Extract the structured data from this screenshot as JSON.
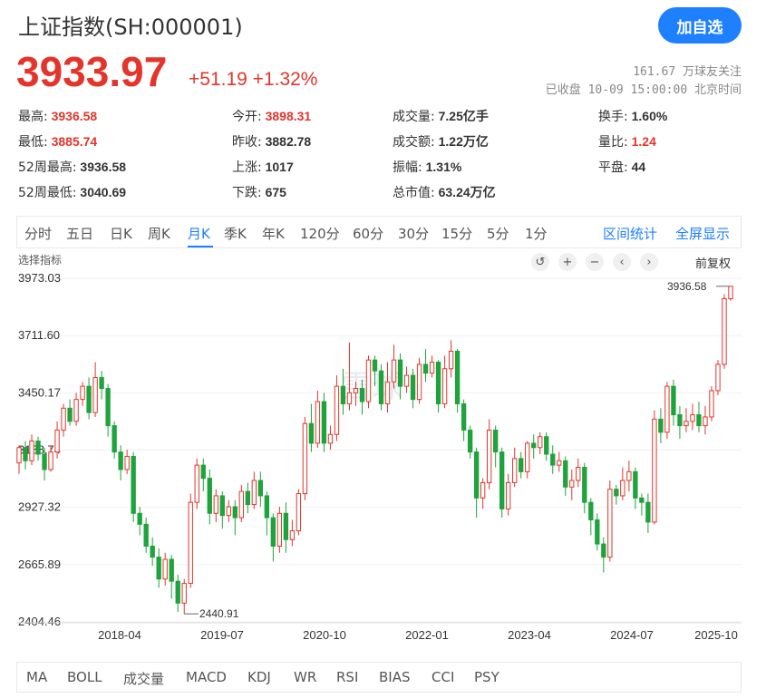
{
  "header": {
    "title": "上证指数(SH:000001)",
    "follow_label": "加自选",
    "price": "3933.97",
    "change": "+51.19",
    "change_pct": "+1.32%",
    "followers": "161.67 万球友关注",
    "status": "已收盘 10-09 15:00:00 北京时间"
  },
  "stats": [
    {
      "label": "最高:",
      "value": "3936.58",
      "red": true
    },
    {
      "label": "今开:",
      "value": "3898.31",
      "red": true
    },
    {
      "label": "成交量:",
      "value": "7.25亿手",
      "red": false
    },
    {
      "label": "换手:",
      "value": "1.60%",
      "red": false
    },
    {
      "label": "最低:",
      "value": "3885.74",
      "red": true
    },
    {
      "label": "昨收:",
      "value": "3882.78",
      "red": false
    },
    {
      "label": "成交额:",
      "value": "1.22万亿",
      "red": false
    },
    {
      "label": "量比:",
      "value": "1.24",
      "red": true
    },
    {
      "label": "52周最高:",
      "value": "3936.58",
      "red": false
    },
    {
      "label": "上涨:",
      "value": "1017",
      "red": false
    },
    {
      "label": "振幅:",
      "value": "1.31%",
      "red": false
    },
    {
      "label": "平盘:",
      "value": "44",
      "red": false
    },
    {
      "label": "52周最低:",
      "value": "3040.69",
      "red": false
    },
    {
      "label": "下跌:",
      "value": "675",
      "red": false
    },
    {
      "label": "总市值:",
      "value": "63.24万亿",
      "red": false
    }
  ],
  "period_tabs": [
    "分时",
    "五日",
    "日K",
    "周K",
    "月K",
    "季K",
    "年K",
    "120分",
    "60分",
    "30分",
    "15分",
    "5分",
    "1分"
  ],
  "active_tab": "月K",
  "right_tabs": [
    "区间统计",
    "全屏显示"
  ],
  "indicator_select": "选择指标",
  "controls": {
    "reset": "↺",
    "zoom_in": "+",
    "zoom_out": "−",
    "prev": "‹",
    "next": "›"
  },
  "adjust_label": "前复权",
  "watermark": "雪球",
  "bottom_tabs": [
    "MA",
    "BOLL",
    "成交量",
    "MACD",
    "KDJ",
    "WR",
    "RSI",
    "BIAS",
    "CCI",
    "PSY"
  ],
  "colors": {
    "up": "#e3352b",
    "down": "#1fa33c",
    "accent": "#1e80ff"
  },
  "chart_data": {
    "type": "candlestick",
    "y_ticks": [
      "3973.03",
      "3711.60",
      "3450.17",
      "3188.74",
      "2927.32",
      "2665.89",
      "2404.46"
    ],
    "ylim": [
      2404.46,
      3973.03
    ],
    "x_ticks": [
      "2018-04",
      "2019-07",
      "2020-10",
      "2022-01",
      "2023-04",
      "2024-07",
      "2025-10"
    ],
    "annotations": {
      "max": "3936.58",
      "min": "2440.91"
    },
    "candles": [
      [
        3130,
        3200,
        3080,
        3210
      ],
      [
        3200,
        3140,
        3100,
        3230
      ],
      [
        3140,
        3230,
        3120,
        3260
      ],
      [
        3230,
        3170,
        3140,
        3250
      ],
      [
        3170,
        3100,
        3050,
        3200
      ],
      [
        3100,
        3180,
        3090,
        3210
      ],
      [
        3180,
        3280,
        3150,
        3320
      ],
      [
        3280,
        3380,
        3250,
        3400
      ],
      [
        3380,
        3320,
        3300,
        3420
      ],
      [
        3320,
        3420,
        3300,
        3450
      ],
      [
        3420,
        3480,
        3390,
        3500
      ],
      [
        3480,
        3360,
        3330,
        3520
      ],
      [
        3360,
        3520,
        3340,
        3590
      ],
      [
        3520,
        3470,
        3420,
        3550
      ],
      [
        3470,
        3300,
        3250,
        3490
      ],
      [
        3300,
        3180,
        3150,
        3320
      ],
      [
        3180,
        3100,
        3050,
        3210
      ],
      [
        3100,
        3160,
        3080,
        3190
      ],
      [
        3160,
        2900,
        2860,
        3180
      ],
      [
        2900,
        2850,
        2800,
        2930
      ],
      [
        2850,
        2750,
        2720,
        2880
      ],
      [
        2750,
        2700,
        2660,
        2790
      ],
      [
        2700,
        2600,
        2560,
        2740
      ],
      [
        2600,
        2690,
        2570,
        2720
      ],
      [
        2690,
        2590,
        2510,
        2710
      ],
      [
        2590,
        2490,
        2450,
        2620
      ],
      [
        2490,
        2580,
        2440,
        2600
      ],
      [
        2580,
        2950,
        2560,
        2990
      ],
      [
        2950,
        3120,
        2920,
        3150
      ],
      [
        3120,
        3060,
        3000,
        3150
      ],
      [
        3060,
        2900,
        2850,
        3100
      ],
      [
        2900,
        2980,
        2860,
        3010
      ],
      [
        2980,
        2890,
        2830,
        3000
      ],
      [
        2890,
        2930,
        2860,
        2960
      ],
      [
        2930,
        2880,
        2800,
        2960
      ],
      [
        2880,
        3000,
        2860,
        3030
      ],
      [
        3000,
        2940,
        2900,
        3040
      ],
      [
        2940,
        3050,
        2920,
        3090
      ],
      [
        3050,
        2980,
        2930,
        3090
      ],
      [
        2980,
        2880,
        2800,
        3000
      ],
      [
        2880,
        2750,
        2680,
        2900
      ],
      [
        2750,
        2900,
        2720,
        2930
      ],
      [
        2900,
        2780,
        2720,
        2950
      ],
      [
        2780,
        2820,
        2750,
        2870
      ],
      [
        2820,
        2990,
        2800,
        3010
      ],
      [
        2990,
        3310,
        2960,
        3340
      ],
      [
        3310,
        3220,
        3180,
        3400
      ],
      [
        3220,
        3410,
        3200,
        3460
      ],
      [
        3410,
        3220,
        3180,
        3450
      ],
      [
        3220,
        3260,
        3190,
        3300
      ],
      [
        3260,
        3480,
        3230,
        3530
      ],
      [
        3480,
        3400,
        3350,
        3560
      ],
      [
        3400,
        3450,
        3370,
        3680
      ],
      [
        3450,
        3470,
        3390,
        3500
      ],
      [
        3470,
        3410,
        3350,
        3510
      ],
      [
        3410,
        3600,
        3380,
        3620
      ],
      [
        3600,
        3550,
        3480,
        3620
      ],
      [
        3550,
        3400,
        3370,
        3580
      ],
      [
        3400,
        3500,
        3360,
        3590
      ],
      [
        3500,
        3600,
        3470,
        3670
      ],
      [
        3600,
        3480,
        3420,
        3630
      ],
      [
        3480,
        3530,
        3450,
        3570
      ],
      [
        3530,
        3420,
        3380,
        3560
      ],
      [
        3420,
        3580,
        3400,
        3610
      ],
      [
        3580,
        3540,
        3500,
        3650
      ],
      [
        3540,
        3590,
        3520,
        3620
      ],
      [
        3590,
        3400,
        3360,
        3600
      ],
      [
        3400,
        3560,
        3380,
        3620
      ],
      [
        3560,
        3640,
        3520,
        3690
      ],
      [
        3640,
        3400,
        3360,
        3650
      ],
      [
        3400,
        3280,
        3230,
        3420
      ],
      [
        3280,
        3180,
        3150,
        3300
      ],
      [
        3180,
        2970,
        2880,
        3200
      ],
      [
        2970,
        3040,
        2920,
        3060
      ],
      [
        3040,
        3280,
        3010,
        3330
      ],
      [
        3280,
        3180,
        3110,
        3300
      ],
      [
        3180,
        2920,
        2880,
        3200
      ],
      [
        2920,
        3040,
        2890,
        3080
      ],
      [
        3040,
        3150,
        3020,
        3200
      ],
      [
        3150,
        3090,
        3060,
        3180
      ],
      [
        3090,
        3220,
        3060,
        3230
      ],
      [
        3220,
        3200,
        3150,
        3260
      ],
      [
        3200,
        3250,
        3170,
        3270
      ],
      [
        3250,
        3170,
        3140,
        3270
      ],
      [
        3170,
        3120,
        3080,
        3210
      ],
      [
        3120,
        3140,
        3090,
        3180
      ],
      [
        3140,
        3020,
        2980,
        3160
      ],
      [
        3020,
        3050,
        2960,
        3100
      ],
      [
        3050,
        3110,
        3020,
        3150
      ],
      [
        3110,
        2950,
        2900,
        3130
      ],
      [
        2950,
        2870,
        2800,
        2970
      ],
      [
        2870,
        2760,
        2730,
        2900
      ],
      [
        2760,
        2700,
        2630,
        2790
      ],
      [
        2700,
        3010,
        2680,
        3050
      ],
      [
        3010,
        2980,
        2940,
        3030
      ],
      [
        2980,
        3050,
        2960,
        3110
      ],
      [
        3050,
        3090,
        3000,
        3140
      ],
      [
        3090,
        2970,
        2920,
        3110
      ],
      [
        2970,
        2950,
        2890,
        2990
      ],
      [
        2950,
        2860,
        2810,
        2990
      ],
      [
        2860,
        3330,
        2850,
        3370
      ],
      [
        3330,
        3270,
        3220,
        3380
      ],
      [
        3270,
        3480,
        3240,
        3500
      ],
      [
        3480,
        3350,
        3300,
        3510
      ],
      [
        3350,
        3300,
        3240,
        3390
      ],
      [
        3300,
        3320,
        3270,
        3380
      ],
      [
        3320,
        3350,
        3280,
        3400
      ],
      [
        3350,
        3300,
        3270,
        3410
      ],
      [
        3300,
        3340,
        3260,
        3390
      ],
      [
        3340,
        3460,
        3320,
        3480
      ],
      [
        3460,
        3580,
        3440,
        3600
      ],
      [
        3580,
        3880,
        3560,
        3900
      ],
      [
        3880,
        3936.58,
        3870,
        3936.58
      ]
    ]
  }
}
